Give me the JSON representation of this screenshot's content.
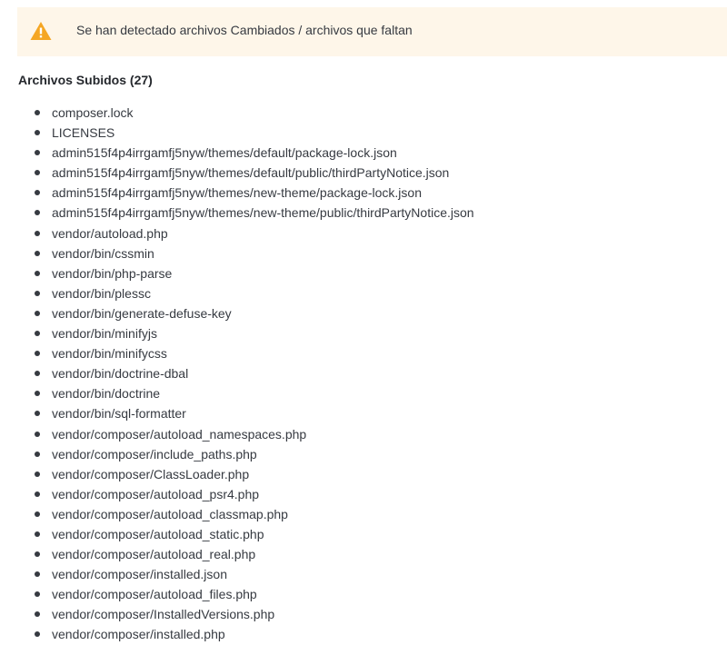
{
  "alert": {
    "icon": "warning-triangle-icon",
    "icon_color": "#f5a623",
    "background": "#fef6e9",
    "message": "Se han detectado archivos Cambiados / archivos que faltan"
  },
  "uploaded": {
    "title": "Archivos Subidos (27)",
    "files": [
      "composer.lock",
      "LICENSES",
      "admin515f4p4irrgamfj5nyw/themes/default/package-lock.json",
      "admin515f4p4irrgamfj5nyw/themes/default/public/thirdPartyNotice.json",
      "admin515f4p4irrgamfj5nyw/themes/new-theme/package-lock.json",
      "admin515f4p4irrgamfj5nyw/themes/new-theme/public/thirdPartyNotice.json",
      "vendor/autoload.php",
      "vendor/bin/cssmin",
      "vendor/bin/php-parse",
      "vendor/bin/plessc",
      "vendor/bin/generate-defuse-key",
      "vendor/bin/minifyjs",
      "vendor/bin/minifycss",
      "vendor/bin/doctrine-dbal",
      "vendor/bin/doctrine",
      "vendor/bin/sql-formatter",
      "vendor/composer/autoload_namespaces.php",
      "vendor/composer/include_paths.php",
      "vendor/composer/ClassLoader.php",
      "vendor/composer/autoload_psr4.php",
      "vendor/composer/autoload_classmap.php",
      "vendor/composer/autoload_static.php",
      "vendor/composer/autoload_real.php",
      "vendor/composer/installed.json",
      "vendor/composer/autoload_files.php",
      "vendor/composer/InstalledVersions.php",
      "vendor/composer/installed.php"
    ]
  }
}
